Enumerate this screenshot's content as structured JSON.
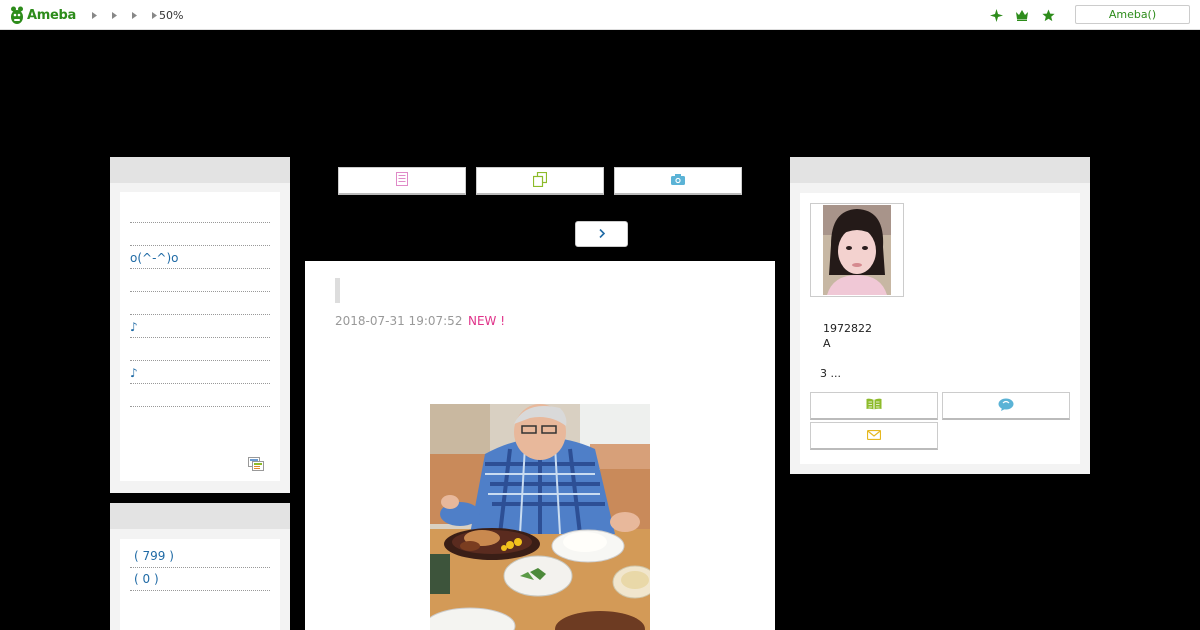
{
  "header": {
    "logo_text": "Ameba",
    "zoom": "50%",
    "login_label": "Ameba()",
    "brand_color": "#2d8c1b"
  },
  "left_sidebar": {
    "recent_entries": [
      "",
      "",
      "o(^-^)o",
      "",
      "",
      "♪",
      "",
      "♪",
      ""
    ],
    "theme_counts": [
      "( 799 )",
      "( 0 )"
    ]
  },
  "toolbar": {
    "buttons": [
      {
        "icon": "document-icon",
        "color": "#e08ac8"
      },
      {
        "icon": "copy-icon",
        "color": "#8dbb2a"
      },
      {
        "icon": "camera-icon",
        "color": "#5bb3d6"
      }
    ]
  },
  "article": {
    "date": "2018-07-31 19:07:52",
    "new_badge": "NEW !",
    "photo_alt": "man eating steak meal"
  },
  "profile": {
    "line1": "1972822",
    "line2": "A",
    "line3": "3 ...",
    "buttons": [
      {
        "icon": "book-icon",
        "color": "#8dbb2a"
      },
      {
        "icon": "speech-bubble-icon",
        "color": "#5bb3d6"
      },
      {
        "icon": "mail-icon",
        "color": "#e6b820"
      }
    ]
  }
}
